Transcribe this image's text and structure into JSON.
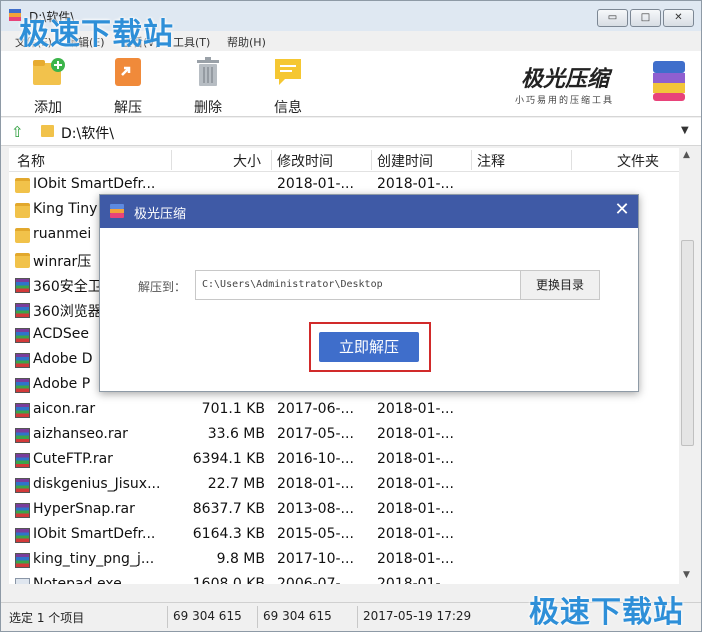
{
  "window": {
    "title": "D:\\软件\\",
    "controls": {
      "minimize": "▭",
      "maximize": "□",
      "close": "✕"
    }
  },
  "watermark": {
    "text": "极速下载站"
  },
  "menu": [
    "文件(F)",
    "编辑(E)",
    "查看(V)",
    "工具(T)",
    "帮助(H)"
  ],
  "toolbar": [
    {
      "label": "添加",
      "icon": "add-folder-icon"
    },
    {
      "label": "解压",
      "icon": "extract-icon"
    },
    {
      "label": "删除",
      "icon": "trash-icon"
    },
    {
      "label": "信息",
      "icon": "info-icon"
    }
  ],
  "brand": {
    "name": "极光压缩",
    "slogan": "小巧易用的压缩工具"
  },
  "address": {
    "path": "D:\\软件\\"
  },
  "columns": {
    "name": "名称",
    "size": "大小",
    "modified": "修改时间",
    "created": "创建时间",
    "comment": "注释",
    "type": "文件夹"
  },
  "rows": [
    {
      "type": "folder",
      "name": "IObit SmartDefr...",
      "size": "",
      "modified": "2018-01-...",
      "created": "2018-01-..."
    },
    {
      "type": "folder",
      "name": "King Tiny",
      "size": "",
      "modified": "",
      "created": ""
    },
    {
      "type": "folder",
      "name": "ruanmei",
      "size": "",
      "modified": "",
      "created": ""
    },
    {
      "type": "folder",
      "name": "winrar压",
      "size": "",
      "modified": "",
      "created": ""
    },
    {
      "type": "rar",
      "name": "360安全卫",
      "size": "",
      "modified": "",
      "created": ""
    },
    {
      "type": "rar",
      "name": "360浏览器",
      "size": "",
      "modified": "",
      "created": ""
    },
    {
      "type": "rar",
      "name": "ACDSee",
      "size": "",
      "modified": "",
      "created": ""
    },
    {
      "type": "rar",
      "name": "Adobe D",
      "size": "",
      "modified": "",
      "created": ""
    },
    {
      "type": "rar",
      "name": "Adobe P",
      "size": "",
      "modified": "",
      "created": ""
    },
    {
      "type": "rar",
      "name": "aicon.rar",
      "size": "701.1 KB",
      "modified": "2017-06-...",
      "created": "2018-01-..."
    },
    {
      "type": "rar",
      "name": "aizhanseo.rar",
      "size": "33.6 MB",
      "modified": "2017-05-...",
      "created": "2018-01-..."
    },
    {
      "type": "rar",
      "name": "CuteFTP.rar",
      "size": "6394.1 KB",
      "modified": "2016-10-...",
      "created": "2018-01-..."
    },
    {
      "type": "rar",
      "name": "diskgenius_Jisux...",
      "size": "22.7 MB",
      "modified": "2018-01-...",
      "created": "2018-01-..."
    },
    {
      "type": "rar",
      "name": "HyperSnap.rar",
      "size": "8637.7 KB",
      "modified": "2013-08-...",
      "created": "2018-01-..."
    },
    {
      "type": "rar",
      "name": "IObit SmartDefr...",
      "size": "6164.3 KB",
      "modified": "2015-05-...",
      "created": "2018-01-..."
    },
    {
      "type": "rar",
      "name": "king_tiny_png_j...",
      "size": "9.8 MB",
      "modified": "2017-10-...",
      "created": "2018-01-..."
    },
    {
      "type": "exe",
      "name": "Notepad.exe",
      "size": "1608.0 KB",
      "modified": "2006-07-...",
      "created": "2018-01-..."
    }
  ],
  "status": {
    "selection": "选定 1 个项目",
    "size1": "69 304 615",
    "size2": "69 304 615",
    "datetime": "2017-05-19 17:29"
  },
  "dialog": {
    "title": "极光压缩",
    "extract_to_label": "解压到：",
    "path_value": "C:\\Users\\Administrator\\Desktop",
    "browse_label": "更换目录",
    "extract_now_label": "立即解压",
    "close": "✕"
  },
  "colors": {
    "dialog_title_bg": "#3f5aa6",
    "primary_button": "#3f6ecb",
    "highlight_frame": "#d12a2a",
    "watermark": "#2e8fd8"
  }
}
